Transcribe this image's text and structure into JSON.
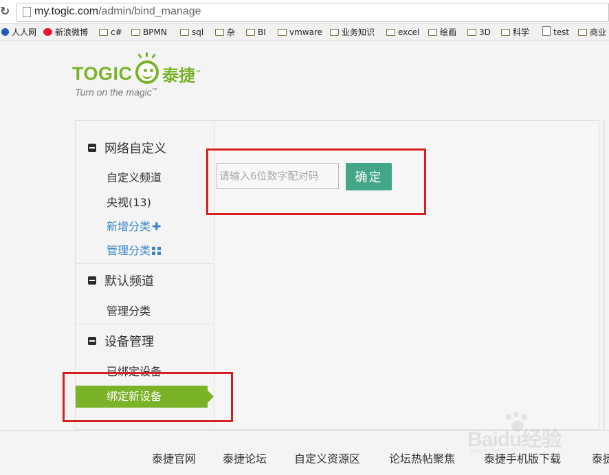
{
  "browser": {
    "url_host": "my.togic.com",
    "url_path": "/admin/bind_manage",
    "bookmarks": [
      {
        "label": "人人网",
        "icon": "renren-icon"
      },
      {
        "label": "新浪微博",
        "icon": "weibo-icon"
      },
      {
        "label": "c#",
        "icon": "folder-icon"
      },
      {
        "label": "BPMN",
        "icon": "folder-icon"
      },
      {
        "label": "sql",
        "icon": "folder-icon"
      },
      {
        "label": "杂",
        "icon": "folder-icon"
      },
      {
        "label": "BI",
        "icon": "folder-icon"
      },
      {
        "label": "vmware",
        "icon": "folder-icon"
      },
      {
        "label": "业务知识",
        "icon": "folder-icon"
      },
      {
        "label": "excel",
        "icon": "folder-icon"
      },
      {
        "label": "绘画",
        "icon": "folder-icon"
      },
      {
        "label": "3D",
        "icon": "folder-icon"
      },
      {
        "label": "科学",
        "icon": "folder-icon"
      },
      {
        "label": "test",
        "icon": "page-icon"
      },
      {
        "label": "商业",
        "icon": "folder-icon"
      }
    ]
  },
  "logo": {
    "word": "TOGIC",
    "cn": "泰捷",
    "tm": "™",
    "tagline": "Turn on the magic"
  },
  "sidebar": {
    "sections": [
      {
        "title": "网络自定义",
        "items": [
          {
            "label": "自定义频道"
          },
          {
            "label": "央视(13)"
          },
          {
            "label": "新增分类",
            "icon": "plus-icon"
          },
          {
            "label": "管理分类",
            "icon": "grid-icon"
          }
        ]
      },
      {
        "title": "默认频道",
        "items": [
          {
            "label": "管理分类"
          }
        ]
      },
      {
        "title": "设备管理",
        "items": [
          {
            "label": "已绑定设备"
          },
          {
            "label": "绑定新设备",
            "active": true
          }
        ]
      }
    ]
  },
  "main": {
    "pair_input": {
      "placeholder": "请输入6位数字配对码",
      "value": ""
    },
    "confirm_label": "确定"
  },
  "footer": {
    "links": [
      "泰捷官网",
      "泰捷论坛",
      "自定义资源区",
      "论坛热帖聚焦",
      "泰捷手机版下载",
      "泰捷"
    ]
  },
  "watermark": {
    "text": "Baidu经验",
    "sub": "jingyan.baidu.com"
  },
  "colors": {
    "brand_green": "#7ab228",
    "button_teal": "#43a689",
    "link_blue": "#3a86c8",
    "annotation_red": "#d62020"
  }
}
